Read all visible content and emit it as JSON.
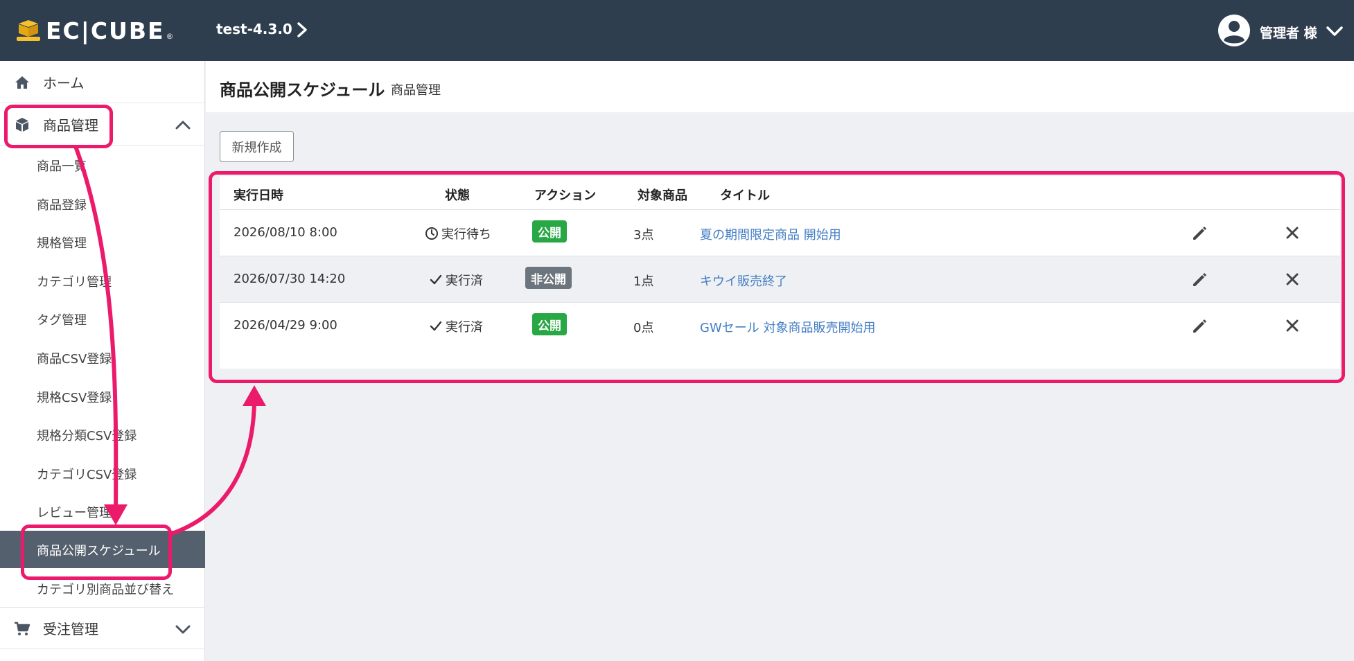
{
  "header": {
    "logo_text": "EC|CUBE",
    "logo_reg": "®",
    "shop_name": "test-4.3.0",
    "user_name": "管理者 様"
  },
  "sidebar": {
    "home_label": "ホーム",
    "product_label": "商品管理",
    "order_label": "受注管理",
    "product_items": [
      "商品一覧",
      "商品登録",
      "規格管理",
      "カテゴリ管理",
      "タグ管理",
      "商品CSV登録",
      "規格CSV登録",
      "規格分類CSV登録",
      "カテゴリCSV登録",
      "レビュー管理",
      "商品公開スケジュール",
      "カテゴリ別商品並び替え"
    ],
    "active_item": "商品公開スケジュール"
  },
  "page": {
    "title": "商品公開スケジュール",
    "subtitle": "商品管理",
    "new_button": "新規作成"
  },
  "table": {
    "headers": [
      "実行日時",
      "状態",
      "アクション",
      "対象商品",
      "タイトル"
    ],
    "rows": [
      {
        "datetime": "2026/08/10 8:00",
        "status": "実行待ち",
        "status_icon": "clock-icon",
        "action": "公開",
        "action_color": "#28a745",
        "target": "3点",
        "title": "夏の期間限定商品 開始用"
      },
      {
        "datetime": "2026/07/30 14:20",
        "status": "実行済",
        "status_icon": "check-icon",
        "action": "非公開",
        "action_color": "#6c757d",
        "target": "1点",
        "title": "キウイ販売終了"
      },
      {
        "datetime": "2026/04/29 9:00",
        "status": "実行済",
        "status_icon": "check-icon",
        "action": "公開",
        "action_color": "#28a745",
        "target": "0点",
        "title": "GWセール 対象商品販売開始用"
      }
    ]
  },
  "colors": {
    "header_bg": "#2f3e4e",
    "highlight": "#ec1a6a",
    "link": "#437ec4",
    "active_nav": "#54606e"
  }
}
